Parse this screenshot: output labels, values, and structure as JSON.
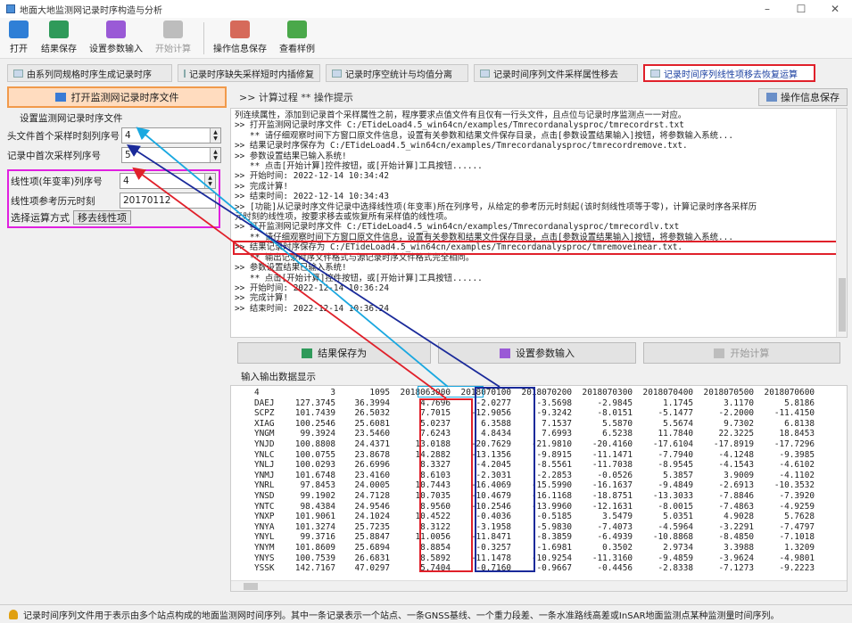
{
  "window": {
    "title": "地面大地监测网记录时序构造与分析",
    "minimize": "–",
    "maximize": "☐",
    "close": "✕"
  },
  "toolbar": [
    {
      "label": "打开",
      "icon": "open-icon",
      "color": "#2f7fd6"
    },
    {
      "label": "结果保存",
      "icon": "save-icon",
      "color": "#2f9a5a"
    },
    {
      "label": "设置参数输入",
      "icon": "settings-icon",
      "color": "#9a5ad6"
    },
    {
      "label": "开始计算",
      "icon": "run-icon",
      "color": "#a0a0a0"
    },
    {
      "label": "操作信息保存",
      "icon": "log-save-icon",
      "color": "#d66a5a"
    },
    {
      "label": "查看样例",
      "icon": "sample-icon",
      "color": "#4aa84a"
    }
  ],
  "tabs": [
    "由系列同规格时序生成记录时序",
    "记录时序缺失采样短时内插修复",
    "记录时序空统计与均值分离",
    "记录时间序列文件采样属性移去",
    "记录时间序列线性项移去恢复运算"
  ],
  "left": {
    "open_button": "打开监测网记录时序文件",
    "group_label": "设置监测网记录时序文件",
    "field1_label": "头文件首个采样时刻列序号",
    "field1_value": "4",
    "field2_label": "记录中首次采样列序号",
    "field2_value": "5",
    "field3_label": "线性项(年变率)列序号",
    "field3_value": "4",
    "field4_label": "线性项参考历元时刻",
    "field4_value": "20170112",
    "method_label": "选择运算方式",
    "method_value": "移去线性项"
  },
  "log": {
    "caption": ">> 计算过程  ** 操作提示",
    "save_button": "操作信息保存",
    "lines": [
      "列连续属性，添加到记录首个采样属性之前，程序要求点值文件有且仅有一行头文件，且点位与记录时序监测点一一对应。",
      ">> 打开监测网记录时序文件 C:/ETideLoad4.5_win64cn/examples/Tmrecordanalysproc/tmrecordrst.txt",
      "   ** 请仔细观察时间下方窗口原文件信息，设置有关参数和结果文件保存目录，点击[参数设置结果输入]按钮，将参数输入系统...",
      ">> 结果记录时序保存为 C:/ETideLoad4.5_win64cn/examples/Tmrecordanalysproc/tmrecordremove.txt.",
      ">> 参数设置结果已输入系统!",
      "   ** 点击[开始计算]控件按钮，或[开始计算]工具按钮......",
      ">> 开始时间: 2022-12-14 10:34:42",
      ">> 完成计算!",
      ">> 结束时间: 2022-12-14 10:34:43",
      ">> [功能]从记录时序文件记录中选择线性项(年变率)所在列序号，从给定的参考历元时刻起(该时刻线性项等于零)，计算记录时序各采样历",
      "元时刻的线性项，按要求移去或恢复所有采样值的线性项。",
      ">> 打开监测网记录时序文件 C:/ETideLoad4.5_win64cn/examples/Tmrecordanalysproc/tmrecordlv.txt",
      "   ** 请仔细观察时间下方窗口原文件信息，设置有关参数和结果文件保存目录，点击[参数设置结果输入]按钮，将参数输入系统...",
      ">> 结果记录时序保存为 C:/ETideLoad4.5_win64cn/examples/Tmrecordanalysproc/tmremoveinear.txt.",
      "   ** 输出记录时序文件格式与源记录时序文件格式完全相同。",
      ">> 参数设置结果已输入系统!",
      "   ** 点击[开始计算]控件按钮，或[开始计算]工具按钮......",
      ">> 开始时间: 2022-12-14 10:36:24",
      ">> 完成计算!",
      ">> 结束时间: 2022-12-14 10:36:24"
    ]
  },
  "actions": {
    "save": "结果保存为",
    "params": "设置参数输入",
    "run": "开始计算"
  },
  "io": {
    "label": "输入输出数据显示",
    "header": [
      "4",
      "3",
      "1095",
      "2018063000",
      "2018070100",
      "2018070200",
      "2018070300",
      "2018070400",
      "2018070500",
      "2018070600"
    ],
    "rows": [
      [
        "DAEJ",
        "127.3745",
        "36.3994",
        "4.7696",
        "-2.0277",
        "-3.5698",
        "-2.9845",
        "1.1745",
        "3.1170",
        "5.8186"
      ],
      [
        "SCPZ",
        "101.7439",
        "26.5032",
        "7.7015",
        "-12.9056",
        "-9.3242",
        "-8.0151",
        "-5.1477",
        "-2.2000",
        "-11.4150"
      ],
      [
        "XIAG",
        "100.2546",
        "25.6081",
        "5.0237",
        "6.3588",
        "7.1537",
        "5.5870",
        "5.5674",
        "9.7302",
        "6.8138"
      ],
      [
        "YNGM",
        "99.3924",
        "23.5460",
        "7.6243",
        "4.8434",
        "7.6993",
        "6.5238",
        "11.7840",
        "22.3225",
        "18.8453"
      ],
      [
        "YNJD",
        "100.8808",
        "24.4371",
        "13.0188",
        "-20.7629",
        "-21.9810",
        "-20.4160",
        "-17.6104",
        "-17.8919",
        "-17.7296"
      ],
      [
        "YNLC",
        "100.0755",
        "23.8678",
        "14.2882",
        "-13.1356",
        "-9.8915",
        "-11.1471",
        "-7.7940",
        "-4.1248",
        "-9.3985"
      ],
      [
        "YNLJ",
        "100.0293",
        "26.6996",
        "8.3327",
        "-4.2045",
        "-8.5561",
        "-11.7038",
        "-8.9545",
        "-4.1543",
        "-4.6102"
      ],
      [
        "YNMJ",
        "101.6748",
        "23.4160",
        "8.6103",
        "-2.3031",
        "-2.2853",
        "-0.0526",
        "5.3857",
        "3.9009",
        "-4.1102"
      ],
      [
        "YNRL",
        "97.8453",
        "24.0005",
        "10.7443",
        "-16.4069",
        "-15.5990",
        "-16.1637",
        "-9.4849",
        "-2.6913",
        "-10.3532"
      ],
      [
        "YNSD",
        "99.1902",
        "24.7128",
        "10.7035",
        "-10.4679",
        "-16.1168",
        "-18.8751",
        "-13.3033",
        "-7.8846",
        "-7.3920"
      ],
      [
        "YNTC",
        "98.4384",
        "24.9546",
        "8.9560",
        "-10.2546",
        "-13.9960",
        "-12.1631",
        "-8.0015",
        "-7.4863",
        "-4.9259"
      ],
      [
        "YNXP",
        "101.9061",
        "24.1024",
        "10.4522",
        "-0.4036",
        "-0.5185",
        "3.5479",
        "5.0351",
        "4.9028",
        "5.7628"
      ],
      [
        "YNYA",
        "101.3274",
        "25.7235",
        "8.3122",
        "-3.1958",
        "-5.9830",
        "-7.4073",
        "-4.5964",
        "-3.2291",
        "-7.4797"
      ],
      [
        "YNYL",
        "99.3716",
        "25.8847",
        "11.0056",
        "-11.8471",
        "-8.3859",
        "-6.4939",
        "-10.8868",
        "-8.4850",
        "-7.1018"
      ],
      [
        "YNYM",
        "101.8609",
        "25.6894",
        "8.8854",
        "-0.3257",
        "-1.6981",
        "0.3502",
        "2.9734",
        "3.3988",
        "1.3209"
      ],
      [
        "YNYS",
        "100.7539",
        "26.6831",
        "8.5892",
        "-11.1478",
        "-10.9254",
        "-11.3160",
        "-9.4859",
        "-3.9624",
        "-4.9801"
      ],
      [
        "YSSK",
        "142.7167",
        "47.0297",
        "5.7404",
        "-0.7160",
        "-0.9667",
        "-0.4456",
        "-2.8338",
        "-7.1273",
        "-9.2223"
      ]
    ]
  },
  "status": "记录时间序列文件用于表示由多个站点构成的地面监测网时间序列。其中一条记录表示一个站点、一条GNSS基线、一个重力段差、一条水准路线高差或InSAR地面监测点某种监测量时间序列。"
}
